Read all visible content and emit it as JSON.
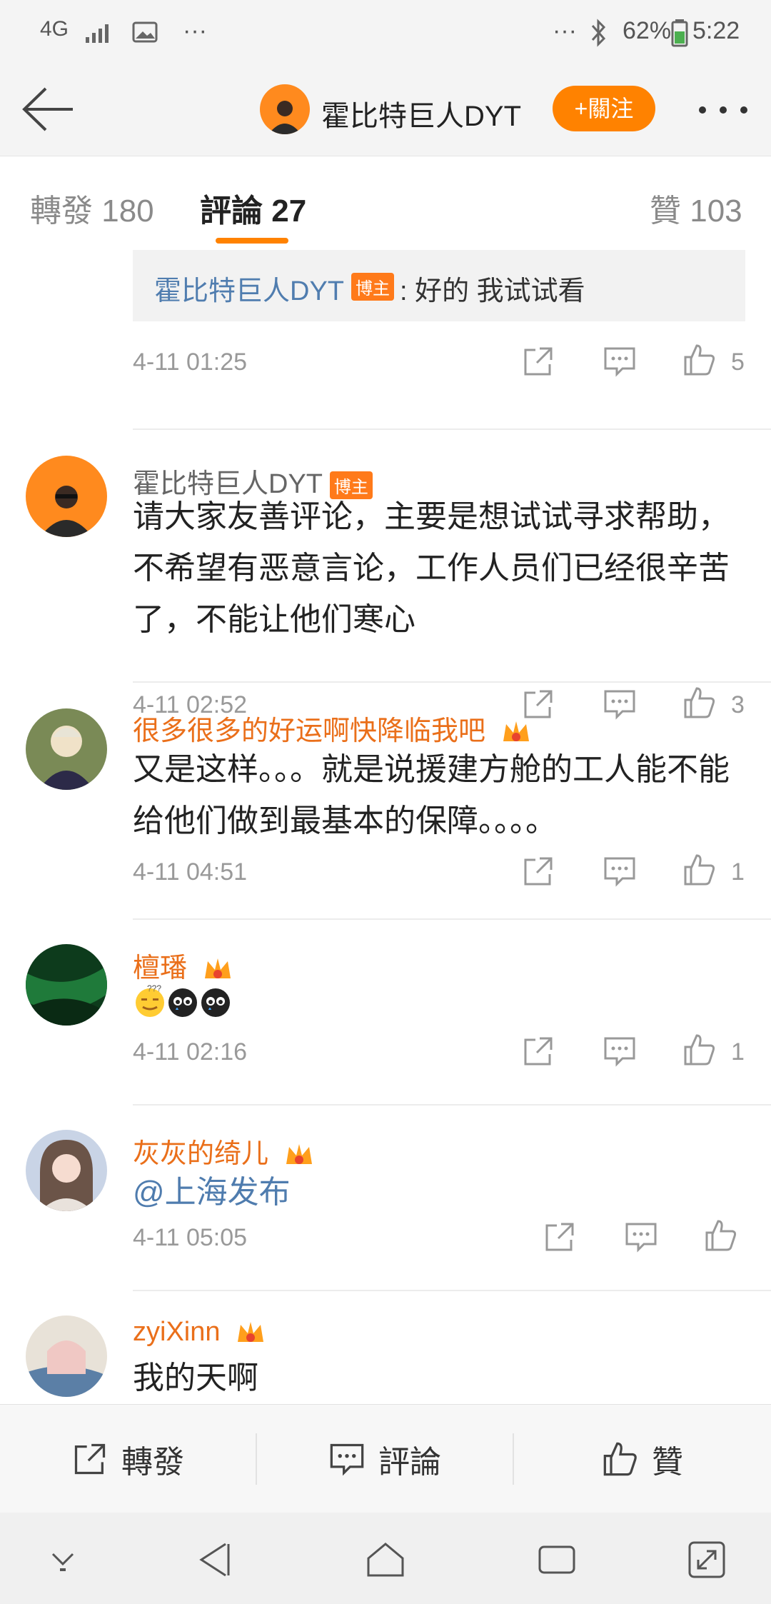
{
  "status_bar": {
    "network": "4G",
    "more": "···",
    "more_right": "···",
    "battery": "62%",
    "time": "5:22"
  },
  "header": {
    "username": "霍比特巨人DYT",
    "follow_label": "+關注"
  },
  "tabs": [
    {
      "label": "轉發",
      "count": "180"
    },
    {
      "label": "評論",
      "count": "27"
    },
    {
      "label": "贊",
      "count": "103"
    }
  ],
  "reply": {
    "name": "霍比特巨人DYT",
    "badge": "博主",
    "text": ": 好的 我试试看"
  },
  "comments": [
    {
      "time": "4-11 01:25",
      "likes": "5"
    },
    {
      "name": "霍比特巨人DYT",
      "badge": "博主",
      "text": "请大家友善评论，主要是想试试寻求帮助，不希望有恶意言论，工作人员们已经很辛苦了，不能让他们寒心",
      "time": "4-11 02:52",
      "likes": "3"
    },
    {
      "name": "很多很多的好运啊快降临我吧",
      "text": "又是这样。。。就是说援建方舱的工人能不能给他们做到最基本的保障。。。。",
      "time": "4-11 04:51",
      "likes": "1"
    },
    {
      "name": "檀璠",
      "text": "",
      "time": "4-11 02:16",
      "likes": "1"
    },
    {
      "name": "灰灰的绮儿",
      "text": "@上海发布",
      "time": "4-11 05:05",
      "likes": ""
    },
    {
      "name": "zyiXinn",
      "text": "我的天啊"
    }
  ],
  "bottom_bar": {
    "repost": "轉發",
    "comment": "評論",
    "like": "贊"
  },
  "colors": {
    "accent": "#ff8200",
    "vip_name": "#ea6f1a",
    "link": "#4f7cae"
  }
}
